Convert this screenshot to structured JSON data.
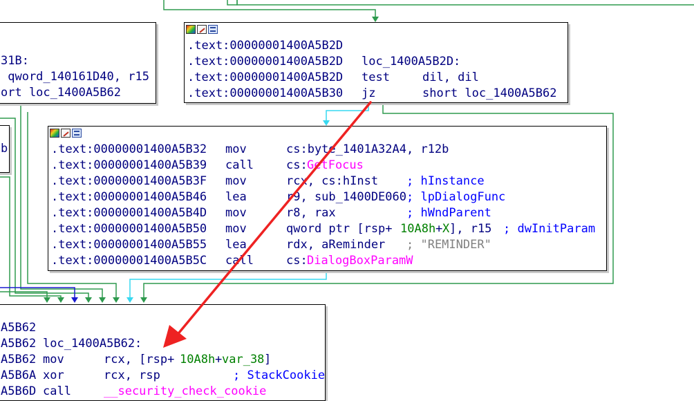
{
  "colors": {
    "edge_green": "#2e9a4e",
    "edge_cyan": "#37d8f0",
    "edge_blue": "#1a1ad0",
    "annotation_arrow": "#ee2222",
    "code_text": "#000080",
    "import_name": "#ff00ff",
    "numeric_operand": "#008000",
    "comment": "#0000ff",
    "string_comment": "#808080"
  },
  "header_icons": [
    "graph-color-icon",
    "edit-node-icon",
    "node-window-icon"
  ],
  "left_node_top": {
    "lines": [
      "31B:",
      " qword_140161D40, r15",
      "ort loc_1400A5B62"
    ]
  },
  "left_node_mid": {
    "lines": [
      "b"
    ]
  },
  "node_top": {
    "lines": [
      {
        "addr": ".text:00000001400A5B2D",
        "mn": "",
        "op": ""
      },
      {
        "addr": ".text:00000001400A5B2D",
        "mn": "loc_1400A5B2D:",
        "op": ""
      },
      {
        "addr": ".text:00000001400A5B2D",
        "mn": "test",
        "op": "dil, dil"
      },
      {
        "addr": ".text:00000001400A5B30",
        "mn": "jz",
        "op": "short loc_1400A5B62"
      }
    ]
  },
  "node_middle": {
    "lines": [
      {
        "addr": ".text:00000001400A5B32",
        "mn": "mov",
        "op": "cs:byte_1401A32A4, r12b"
      },
      {
        "addr": ".text:00000001400A5B39",
        "mn": "call",
        "op_prefix": "cs:",
        "op_import": "GetFocus"
      },
      {
        "addr": ".text:00000001400A5B3F",
        "mn": "mov",
        "op": "rcx, cs:hInst",
        "comment": "; hInstance"
      },
      {
        "addr": ".text:00000001400A5B46",
        "mn": "lea",
        "op": "r9, sub_1400DE060",
        "comment": "; lpDialogFunc"
      },
      {
        "addr": ".text:00000001400A5B4D",
        "mn": "mov",
        "op": "r8, rax",
        "comment": "; hWndParent"
      },
      {
        "addr": ".text:00000001400A5B50",
        "mn": "mov",
        "op_a": "qword ptr [rsp+",
        "op_num": "10A8h",
        "op_b": "+",
        "op_num2": "X",
        "op_c": "], r15",
        "comment": "; dwInitParam"
      },
      {
        "addr": ".text:00000001400A5B55",
        "mn": "lea",
        "op": "rdx, aReminder",
        "comment": "; \"REMINDER\""
      },
      {
        "addr": ".text:00000001400A5B5C",
        "mn": "call",
        "op_prefix": "cs:",
        "op_import": "DialogBoxParamW"
      }
    ]
  },
  "node_bottom": {
    "lines": [
      {
        "addr": "A5B62",
        "mn": "",
        "op": ""
      },
      {
        "addr": "A5B62",
        "mn": "loc_1400A5B62:",
        "op": ""
      },
      {
        "addr": "A5B62",
        "mn": "mov",
        "op_a": "rcx, [rsp+",
        "op_num": "10A8h",
        "op_b": "+",
        "op_num2": "var_38",
        "op_c": "]"
      },
      {
        "addr": "A5B6A",
        "mn": "xor",
        "op": "rcx, rsp",
        "comment": "; StackCookie"
      },
      {
        "addr": "A5B6D",
        "mn": "call",
        "op_import": "__security_check_cookie"
      }
    ]
  }
}
